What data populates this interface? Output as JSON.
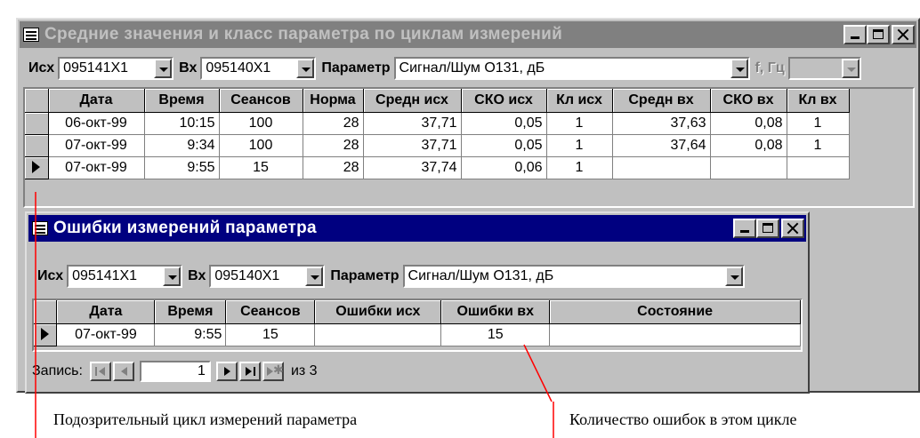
{
  "main_window": {
    "title": "Средние значения и класс параметра по циклам измерений",
    "filter": {
      "isx_label": "Исх",
      "isx_value": "095141X1",
      "vx_label": "Вх",
      "vx_value": "095140X1",
      "param_label": "Параметр",
      "param_value": "Сигнал/Шум O131, дБ",
      "freq_label": "f, Гц"
    },
    "columns": [
      "Дата",
      "Время",
      "Сеансов",
      "Норма",
      "Средн исх",
      "СКО исх",
      "Кл исх",
      "Средн вх",
      "СКО вх",
      "Кл вх"
    ],
    "rows": [
      [
        "06-окт-99",
        "10:15",
        "100",
        "28",
        "37,71",
        "0,05",
        "1",
        "37,63",
        "0,08",
        "1"
      ],
      [
        "07-окт-99",
        "9:34",
        "100",
        "28",
        "37,71",
        "0,05",
        "1",
        "37,64",
        "0,08",
        "1"
      ],
      [
        "07-окт-99",
        "9:55",
        "15",
        "28",
        "37,74",
        "0,06",
        "1",
        "",
        "",
        ""
      ]
    ]
  },
  "errors_window": {
    "title": "Ошибки измерений параметра",
    "filter": {
      "isx_label": "Исх",
      "isx_value": "095141X1",
      "vx_label": "Вх",
      "vx_value": "095140X1",
      "param_label": "Параметр",
      "param_value": "Сигнал/Шум O131, дБ"
    },
    "columns": [
      "Дата",
      "Время",
      "Сеансов",
      "Ошибки исх",
      "Ошибки вх",
      "Состояние"
    ],
    "rows": [
      [
        "07-окт-99",
        "9:55",
        "15",
        "",
        "15",
        ""
      ]
    ],
    "navigator": {
      "record_label": "Запись:",
      "current": "1",
      "of_label": "из 3"
    }
  },
  "captions": {
    "left": "Подозрительный цикл измерений параметра",
    "right": "Количество ошибок в этом цикле"
  },
  "colors": {
    "title_active": "#000080",
    "title_inactive": "#808080",
    "face": "#c0c0c0",
    "callout_line": "#ff0000"
  }
}
